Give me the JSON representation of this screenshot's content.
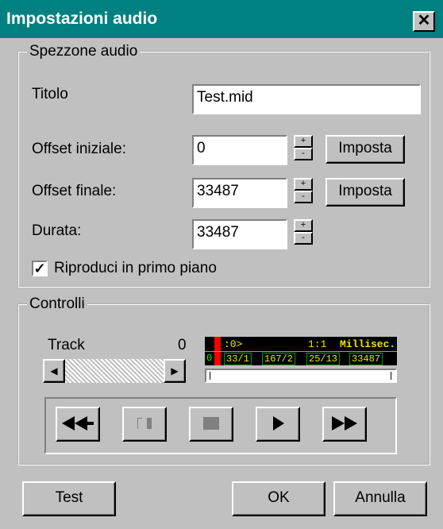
{
  "window": {
    "title": "Impostazioni audio",
    "close_glyph": "✕"
  },
  "segment_group": {
    "label": "Spezzone audio",
    "title_label": "Titolo",
    "title_value": "Test.mid",
    "offset_start_label": "Offset iniziale:",
    "offset_start_value": "0",
    "offset_end_label": "Offset finale:",
    "offset_end_value": "33487",
    "duration_label": "Durata:",
    "duration_value": "33487",
    "set_label": "Imposta",
    "foreground_label": "Riproduci in primo piano",
    "foreground_checked": true
  },
  "controls_group": {
    "label": "Controlli",
    "track_label": "Track",
    "track_value": "0",
    "lcd": {
      "top_left": ":0>",
      "top_mid": "1:1",
      "top_right": "Millisec.",
      "bottom_cells": [
        "0",
        "33/1",
        "167/2",
        "25/13",
        "33487"
      ]
    },
    "transport_icons": [
      "rewind-icon",
      "pause-icon",
      "stop-icon",
      "play-icon",
      "fast-forward-icon"
    ]
  },
  "footer": {
    "test_label": "Test",
    "ok_label": "OK",
    "cancel_label": "Annulla"
  },
  "colors": {
    "titlebar": "#008080",
    "face": "#c0c0c0",
    "lcd_background": "#000000",
    "lcd_text": "#e8e800",
    "position_marker": "#ff0000"
  }
}
